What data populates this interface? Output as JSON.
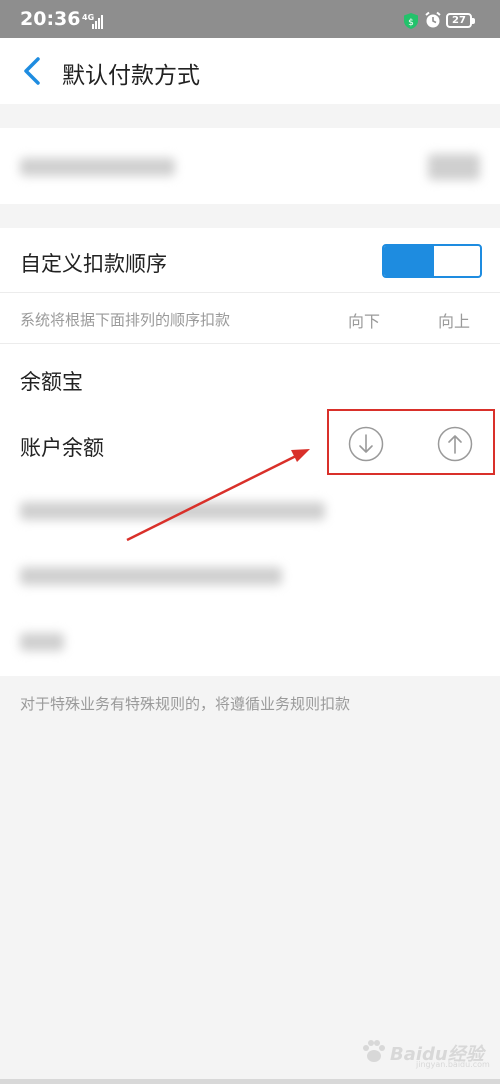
{
  "status_bar": {
    "time": "20:36",
    "network": "4G",
    "battery": "27"
  },
  "header": {
    "title": "默认付款方式"
  },
  "custom_order": {
    "label": "自定义扣款顺序",
    "enabled": true
  },
  "order_hint": {
    "text": "系统将根据下面排列的顺序扣款",
    "down_label": "向下",
    "up_label": "向上"
  },
  "payment_methods": [
    {
      "name": "余额宝"
    },
    {
      "name": "账户余额"
    }
  ],
  "footer_note": "对于特殊业务有特殊规则的，将遵循业务规则扣款",
  "watermark": {
    "text": "Baidu经验",
    "sub": "jingyan.baidu.com"
  },
  "colors": {
    "accent": "#1e8ce0",
    "annotation": "#d9302a"
  },
  "icons": [
    "back-arrow-icon",
    "shield-icon",
    "alarm-icon",
    "battery-icon",
    "arrow-down-circle-icon",
    "arrow-up-circle-icon",
    "paw-icon"
  ]
}
